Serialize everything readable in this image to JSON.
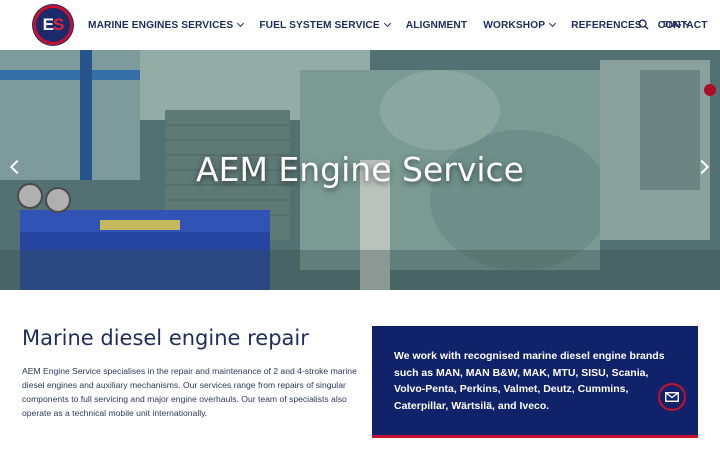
{
  "logo": {
    "text_left": "E",
    "text_right": "S"
  },
  "nav": {
    "items": [
      {
        "label": "MARINE ENGINES SERVICES",
        "has_dropdown": true
      },
      {
        "label": "FUEL SYSTEM SERVICE",
        "has_dropdown": true
      },
      {
        "label": "ALIGNMENT",
        "has_dropdown": false
      },
      {
        "label": "WORKSHOP",
        "has_dropdown": true
      },
      {
        "label": "REFERENCES",
        "has_dropdown": false
      },
      {
        "label": "CONTACT",
        "has_dropdown": false
      }
    ],
    "search_icon": "search-icon",
    "language": "ENG"
  },
  "hero": {
    "title": "AEM Engine Service"
  },
  "main": {
    "heading": "Marine diesel engine repair",
    "paragraph": "AEM Engine Service specialises in the repair and maintenance of 2 and 4-stroke marine diesel engines and auxiliary mechanisms. Our services range from repairs of singular components to full servicing and major engine overhauls. Our team of specialists also operate as a technical mobile unit internationally.",
    "brands_text": "We work with recognised marine diesel engine brands such as MAN, MAN B&W, MAK, MTU, SISU, Scania, Volvo-Penta, Perkins, Valmet, Deutz, Cummins, Caterpillar, Wärtsilä, and Iveco."
  },
  "colors": {
    "brand_navy": "#10226a",
    "brand_red": "#c8102e",
    "nav_text": "#1f2c5c"
  }
}
